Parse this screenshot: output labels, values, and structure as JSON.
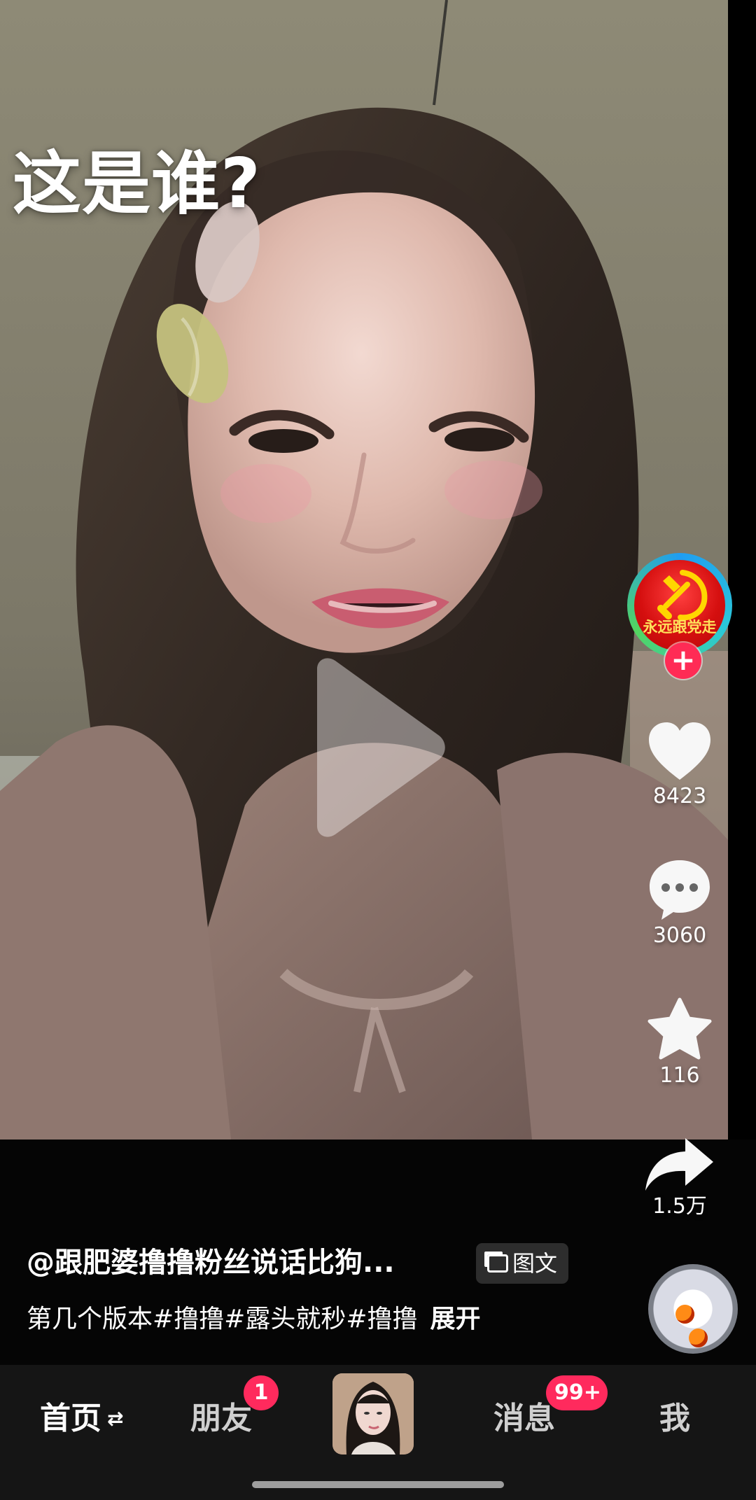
{
  "video": {
    "caption": "这是谁?"
  },
  "actions": {
    "avatar_text": "永远跟党走",
    "like_count": "8423",
    "comment_count": "3060",
    "favorite_count": "116",
    "share_count": "1.5万"
  },
  "post": {
    "author": "@跟肥婆撸撸粉丝说话比狗...",
    "type_label": "图文",
    "description": "第几个版本#撸撸#露头就秒#撸撸",
    "expand": "展开"
  },
  "tabs": {
    "home": "首页",
    "friends": "朋友",
    "friends_badge": "1",
    "messages": "消息",
    "messages_badge": "99+",
    "me": "我"
  },
  "icons": {
    "play": "play-icon",
    "like": "heart-icon",
    "comment": "comment-icon",
    "favorite": "star-icon",
    "share": "share-icon",
    "music": "music-disc-icon"
  },
  "colors": {
    "accent": "#ff2b55",
    "avatar_red": "#d50f0f",
    "background": "#050505"
  }
}
